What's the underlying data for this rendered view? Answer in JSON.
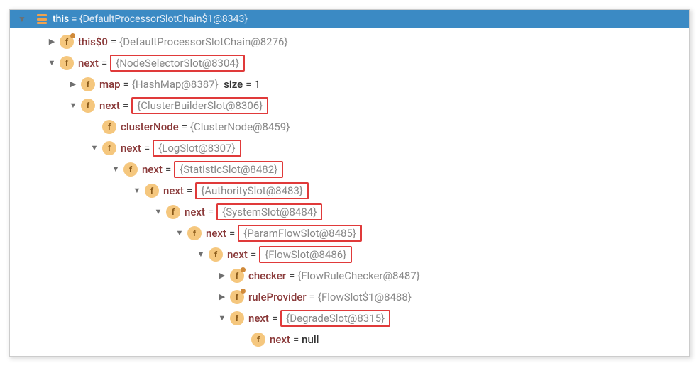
{
  "header": {
    "this_label": "this",
    "this_value": "{DefaultProcessorSlotChain$1@8343}"
  },
  "colors": {
    "accent": "#3b8ac4",
    "highlight_border": "#e03a3a",
    "field_icon_bg": "#f5c77e"
  },
  "tree": [
    {
      "depth": 1,
      "arrow": "right",
      "tag": true,
      "name": "this$0",
      "value": "{DefaultProcessorSlotChain@8276}",
      "boxed": false
    },
    {
      "depth": 1,
      "arrow": "down",
      "tag": false,
      "name": "next",
      "value": "{NodeSelectorSlot@8304}",
      "boxed": true
    },
    {
      "depth": 2,
      "arrow": "right",
      "tag": false,
      "name": "map",
      "value": "{HashMap@8387}",
      "suffix_key": "size",
      "suffix_val": "1",
      "boxed": false
    },
    {
      "depth": 2,
      "arrow": "down",
      "tag": false,
      "name": "next",
      "value": "{ClusterBuilderSlot@8306}",
      "boxed": true
    },
    {
      "depth": 3,
      "arrow": "none",
      "tag": false,
      "name": "clusterNode",
      "value": "{ClusterNode@8459}",
      "boxed": false
    },
    {
      "depth": 3,
      "arrow": "down",
      "tag": false,
      "name": "next",
      "value": "{LogSlot@8307}",
      "boxed": true
    },
    {
      "depth": 4,
      "arrow": "down",
      "tag": false,
      "name": "next",
      "value": "{StatisticSlot@8482}",
      "boxed": true
    },
    {
      "depth": 5,
      "arrow": "down",
      "tag": false,
      "name": "next",
      "value": "{AuthoritySlot@8483}",
      "boxed": true
    },
    {
      "depth": 6,
      "arrow": "down",
      "tag": false,
      "name": "next",
      "value": "{SystemSlot@8484}",
      "boxed": true
    },
    {
      "depth": 7,
      "arrow": "down",
      "tag": false,
      "name": "next",
      "value": "{ParamFlowSlot@8485}",
      "boxed": true
    },
    {
      "depth": 8,
      "arrow": "down",
      "tag": false,
      "name": "next",
      "value": "{FlowSlot@8486}",
      "boxed": true
    },
    {
      "depth": 9,
      "arrow": "right",
      "tag": true,
      "name": "checker",
      "value": "{FlowRuleChecker@8487}",
      "boxed": false
    },
    {
      "depth": 9,
      "arrow": "right",
      "tag": true,
      "name": "ruleProvider",
      "value": "{FlowSlot$1@8488}",
      "boxed": false
    },
    {
      "depth": 9,
      "arrow": "down",
      "tag": false,
      "name": "next",
      "value": "{DegradeSlot@8315}",
      "boxed": true
    },
    {
      "depth": 10,
      "arrow": "none",
      "tag": false,
      "name": "next",
      "value": "null",
      "boxed": false,
      "value_is_kw": true
    }
  ]
}
